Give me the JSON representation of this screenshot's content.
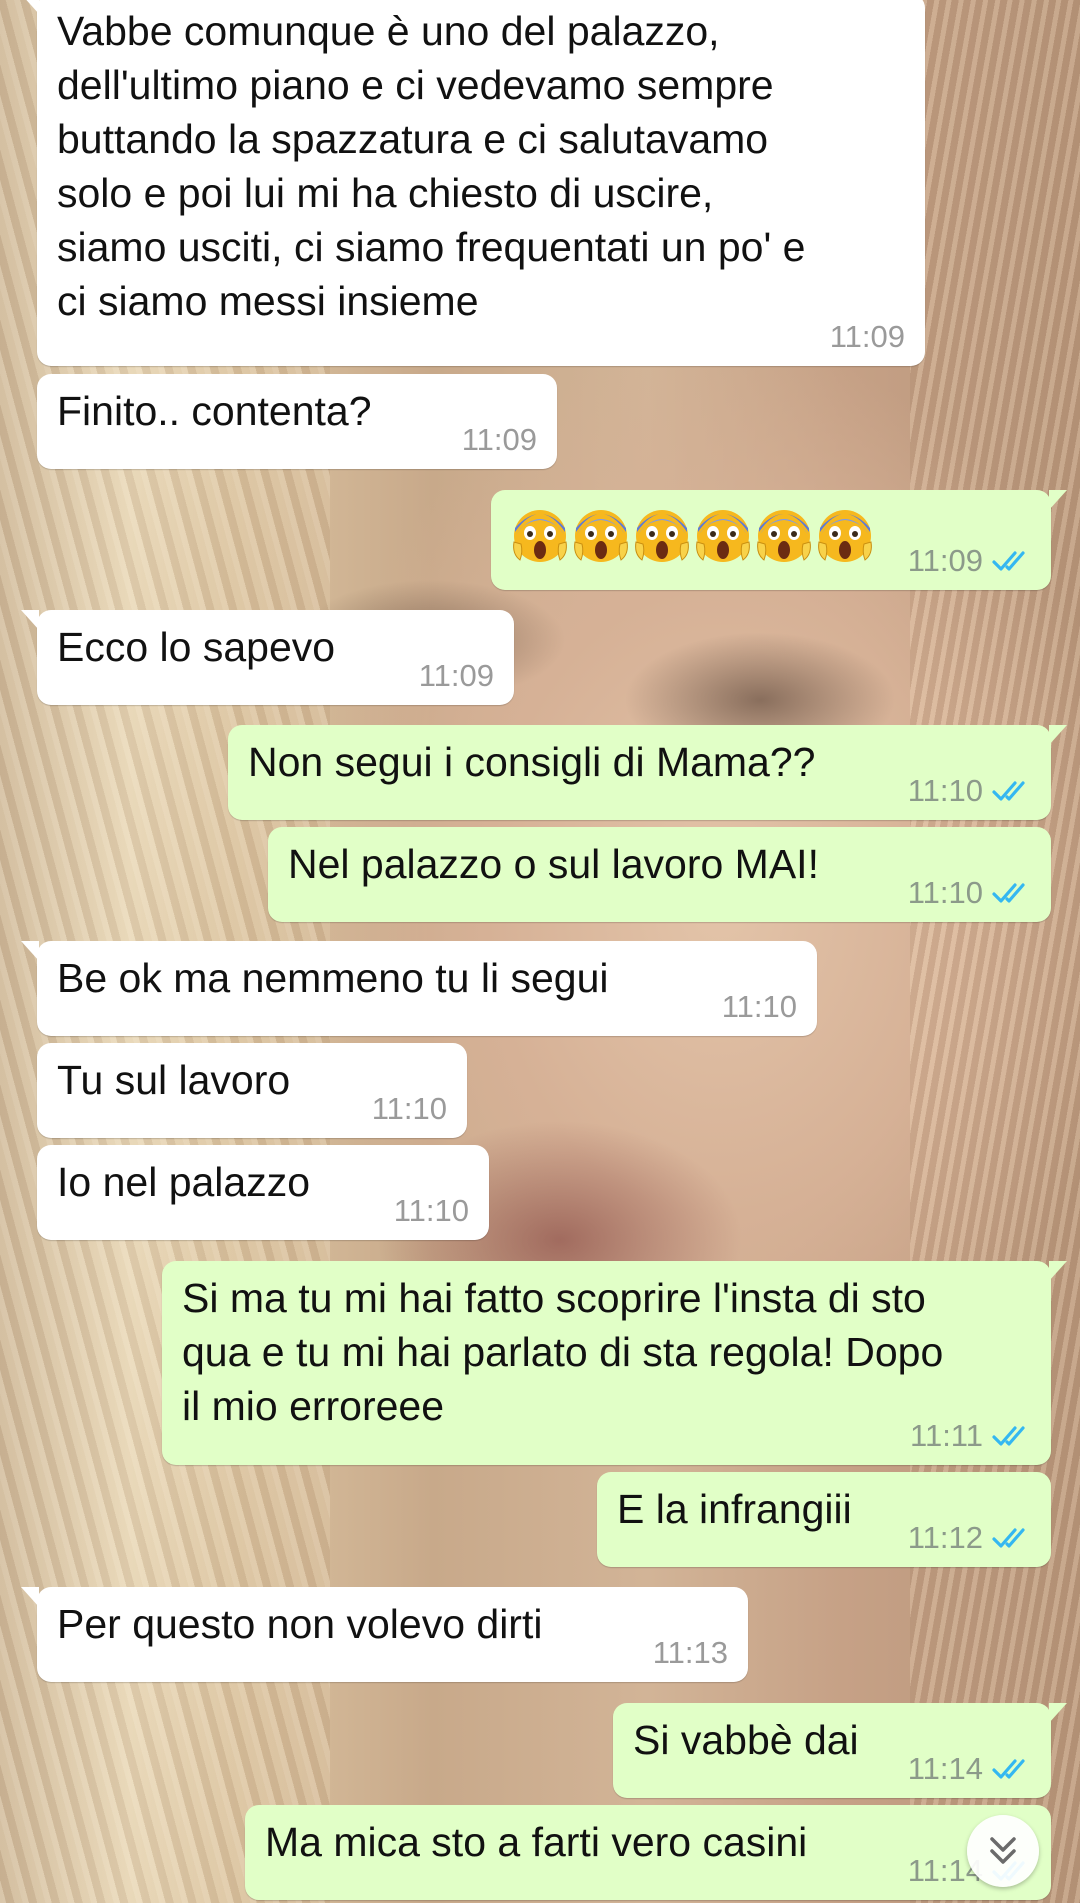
{
  "colors": {
    "incoming_bubble": "#ffffff",
    "outgoing_bubble": "#e1ffc7",
    "tick_read": "#34b7f1"
  },
  "messages": [
    {
      "dir": "in",
      "lines": [
        "Vabbe comunque è uno del palazzo,",
        "dell'ultimo piano e ci vedevamo sempre",
        "buttando la spazzatura e ci salutavamo",
        "solo e poi lui mi ha chiesto di uscire,",
        "siamo usciti, ci siamo frequentati un po' e",
        "ci siamo messi insieme"
      ],
      "time": "11:09"
    },
    {
      "dir": "in",
      "lines": [
        "Finito.. contenta?"
      ],
      "time": "11:09"
    },
    {
      "dir": "out",
      "emoji": "face-screaming-in-fear",
      "emoji_count": 6,
      "time": "11:09",
      "status": "read"
    },
    {
      "dir": "in",
      "lines": [
        "Ecco lo sapevo"
      ],
      "time": "11:09"
    },
    {
      "dir": "out",
      "lines": [
        "Non segui i consigli di Mama??"
      ],
      "time": "11:10",
      "status": "read"
    },
    {
      "dir": "out",
      "lines": [
        "Nel palazzo o sul lavoro MAI!"
      ],
      "time": "11:10",
      "status": "read"
    },
    {
      "dir": "in",
      "lines": [
        "Be ok ma nemmeno tu li segui"
      ],
      "time": "11:10"
    },
    {
      "dir": "in",
      "lines": [
        "Tu sul lavoro"
      ],
      "time": "11:10"
    },
    {
      "dir": "in",
      "lines": [
        "Io nel palazzo"
      ],
      "time": "11:10"
    },
    {
      "dir": "out",
      "lines": [
        "Si ma tu mi hai fatto scoprire l'insta di sto",
        "qua e tu mi hai parlato di sta regola! Dopo",
        "il mio erroreee"
      ],
      "time": "11:11",
      "status": "read"
    },
    {
      "dir": "out",
      "lines": [
        "E la infrangiii"
      ],
      "time": "11:12",
      "status": "read"
    },
    {
      "dir": "in",
      "lines": [
        "Per questo non volevo dirti"
      ],
      "time": "11:13"
    },
    {
      "dir": "out",
      "lines": [
        "Si vabbè dai"
      ],
      "time": "11:14",
      "status": "read"
    },
    {
      "dir": "out",
      "lines": [
        "Ma mica sto a farti vero casini"
      ],
      "time": "11:14",
      "status": "read"
    }
  ],
  "scroll_button": {
    "icon": "double-chevron-down-icon"
  }
}
